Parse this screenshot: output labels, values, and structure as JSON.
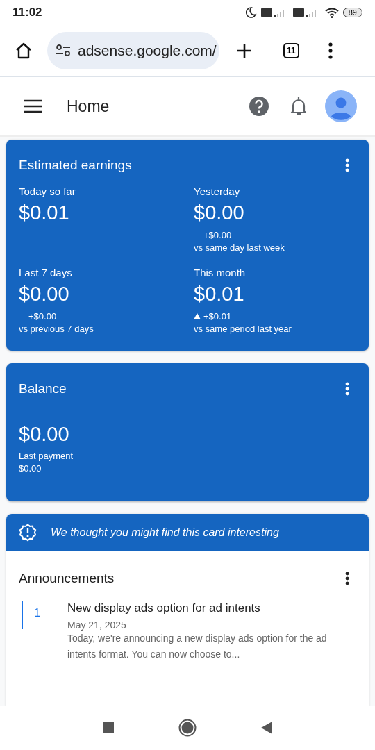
{
  "status_bar": {
    "time": "11:02",
    "battery": "89"
  },
  "browser": {
    "url": "adsense.google.com/",
    "tab_count": "11"
  },
  "header": {
    "title": "Home"
  },
  "earnings": {
    "title": "Estimated earnings",
    "metrics": [
      {
        "label": "Today so far",
        "value": "$0.01"
      },
      {
        "label": "Yesterday",
        "value": "$0.00",
        "rising": false,
        "delta": "+$0.00",
        "note": "vs same day last week"
      },
      {
        "label": "Last 7 days",
        "value": "$0.00",
        "rising": false,
        "delta": "+$0.00",
        "note": "vs previous 7 days"
      },
      {
        "label": "This month",
        "value": "$0.01",
        "rising": true,
        "delta": "+$0.01",
        "note": "vs same period last year"
      }
    ]
  },
  "balance": {
    "title": "Balance",
    "value": "$0.00",
    "label": "Last payment",
    "payment": "$0.00"
  },
  "suggestion": {
    "banner": "We thought you might find this card interesting",
    "title": "Announcements",
    "items": [
      {
        "number": "1",
        "title": "New display ads option for ad intents",
        "date": "May 21, 2025",
        "text": "Today, we're announcing a new display ads option for the ad intents format. You can now choose to..."
      }
    ]
  }
}
